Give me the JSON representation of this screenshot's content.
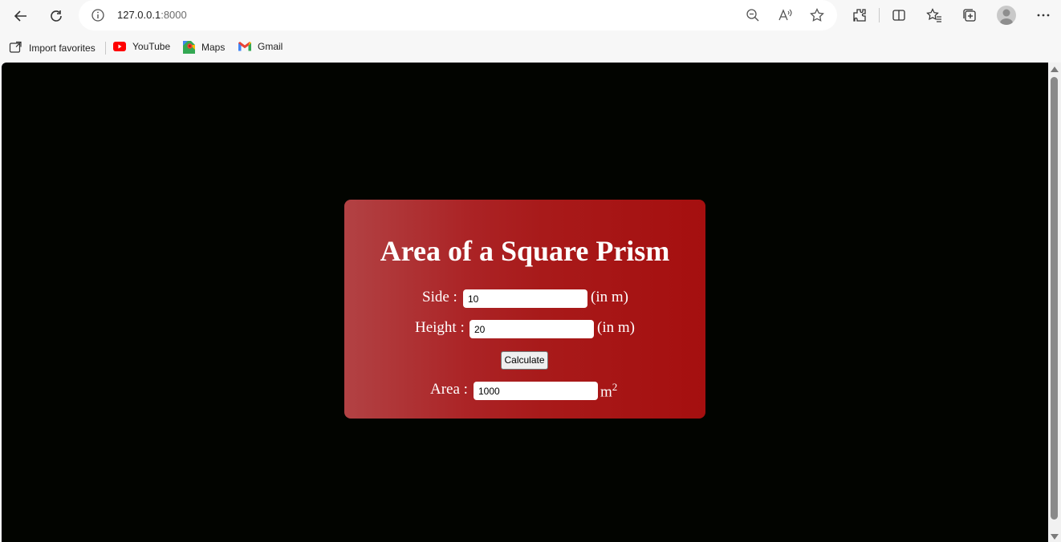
{
  "browser": {
    "url_host": "127.0.0.1",
    "url_port": ":8000"
  },
  "bookmarks": [
    {
      "label": "Import favorites",
      "icon": "import-favorites-icon"
    },
    {
      "label": "YouTube",
      "icon": "youtube-icon"
    },
    {
      "label": "Maps",
      "icon": "maps-icon"
    },
    {
      "label": "Gmail",
      "icon": "gmail-icon"
    }
  ],
  "card": {
    "title": "Area of a Square Prism",
    "side_label": "Side :",
    "side_value": "10",
    "side_unit": "(in m)",
    "height_label": "Height :",
    "height_value": "20",
    "height_unit": "(in m)",
    "calculate_label": "Calculate",
    "area_label": "Area :",
    "area_value": "1000",
    "area_unit": "m",
    "area_unit_exponent": "2"
  },
  "colors": {
    "page_background": "#020400",
    "card_gradient_start": "#b24244",
    "card_gradient_end": "#a50f0f"
  }
}
